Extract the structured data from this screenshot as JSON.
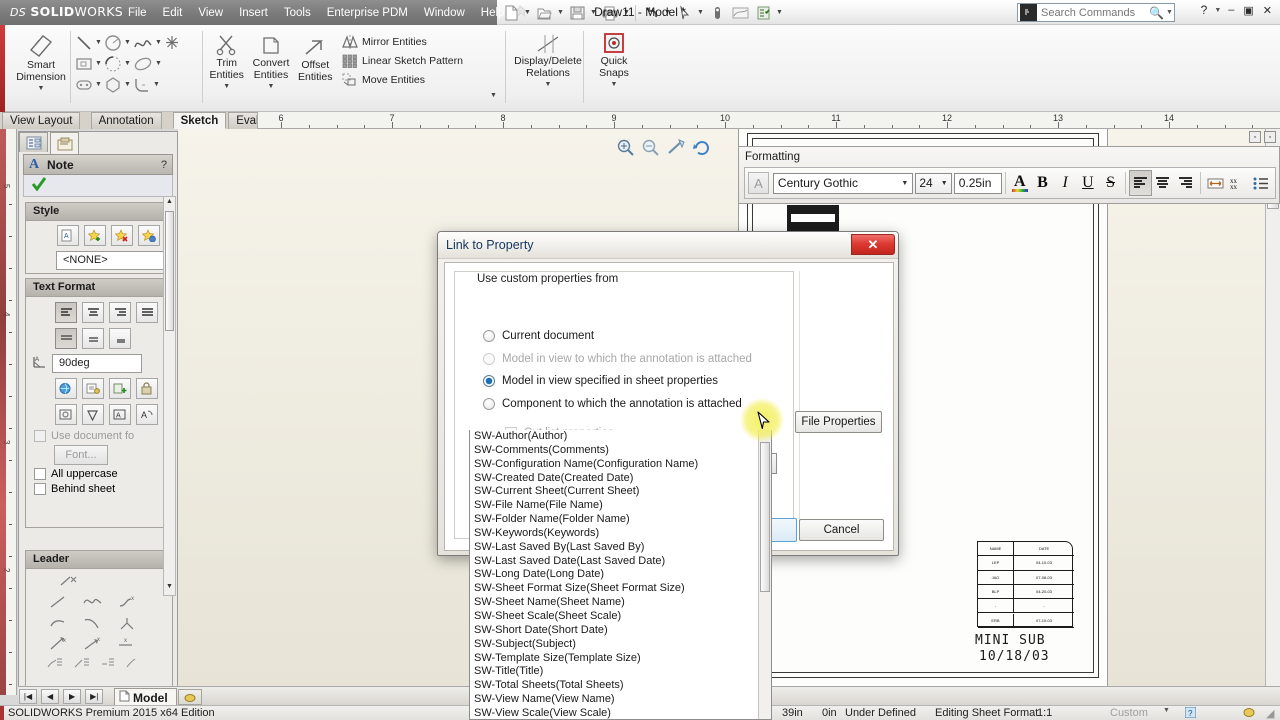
{
  "app": {
    "brand_ds": "DS",
    "brand_name_bold": "SOLID",
    "brand_name_light": "WORKS",
    "document_title": "Draw11 - Model *",
    "status_edition": "SOLIDWORKS Premium 2015 x64 Edition"
  },
  "menu": {
    "items": [
      "File",
      "Edit",
      "View",
      "Insert",
      "Tools",
      "Enterprise PDM",
      "Window",
      "Help"
    ],
    "pin_icon": "pushpin-icon"
  },
  "quickaccess": {
    "items": [
      {
        "name": "new-document-icon",
        "has_caret": true
      },
      {
        "name": "open-document-icon",
        "has_caret": true
      },
      {
        "name": "save-icon",
        "has_caret": true
      },
      {
        "name": "print-icon",
        "has_caret": true
      },
      {
        "name": "undo-icon",
        "has_caret": true
      },
      {
        "name": "select-arrow-icon",
        "has_caret": true
      },
      {
        "name": "measure-icon",
        "has_caret": false
      },
      {
        "name": "section-view-icon",
        "has_caret": false
      },
      {
        "name": "options-icon",
        "has_caret": true
      }
    ]
  },
  "search": {
    "placeholder": "Search Commands",
    "icon": "search-commands-icon",
    "magnifier": "magnifier-icon"
  },
  "window_controls": {
    "help": "?",
    "minimize": "–",
    "restore": "▣",
    "close": "✕"
  },
  "ribbon": {
    "groups": [
      {
        "name": "dimension",
        "buttons": [
          {
            "label_line1": "Smart",
            "label_line2": "Dimension",
            "icon": "smart-dimension-icon",
            "caret": true
          }
        ]
      },
      {
        "name": "sketch-entities",
        "icons": [
          {
            "name": "line-icon",
            "caret": true
          },
          {
            "name": "circle-icon",
            "caret": true
          },
          {
            "name": "spline-icon",
            "caret": true
          },
          {
            "name": "point-icon",
            "caret": false
          },
          {
            "name": "rectangle-icon",
            "caret": true
          },
          {
            "name": "arc-icon",
            "caret": true
          },
          {
            "name": "ellipse-icon",
            "caret": true
          },
          {
            "name": "slot-icon",
            "caret": true
          },
          {
            "name": "polygon-icon",
            "caret": false
          },
          {
            "name": "fillet-icon",
            "caret": true
          }
        ]
      },
      {
        "name": "modify",
        "buttons": [
          {
            "label_line1": "Trim",
            "label_line2": "Entities",
            "icon": "trim-entities-icon",
            "caret": true
          },
          {
            "label_line1": "Convert",
            "label_line2": "Entities",
            "icon": "convert-entities-icon",
            "caret": true
          },
          {
            "label_line1": "Offset",
            "label_line2": "Entities",
            "icon": "offset-entities-icon",
            "caret": false
          }
        ]
      },
      {
        "name": "pattern",
        "small_buttons": [
          {
            "label": "Mirror Entities",
            "icon": "mirror-entities-icon",
            "caret": false
          },
          {
            "label": "Linear Sketch Pattern",
            "icon": "linear-sketch-pattern-icon",
            "caret": true
          },
          {
            "label": "Move Entities",
            "icon": "move-entities-icon",
            "caret": true
          }
        ]
      },
      {
        "name": "relations",
        "buttons": [
          {
            "label_line1": "Display/Delete",
            "label_line2": "Relations",
            "icon": "display-delete-relations-icon",
            "caret": true
          }
        ]
      },
      {
        "name": "snaps",
        "buttons": [
          {
            "label_line1": "Quick",
            "label_line2": "Snaps",
            "icon": "quick-snaps-icon",
            "caret": true
          }
        ]
      }
    ]
  },
  "command_tabs": [
    {
      "label": "View Layout",
      "active": false
    },
    {
      "label": "Annotation",
      "active": false
    },
    {
      "label": "Sketch",
      "active": true
    },
    {
      "label": "Evaluate",
      "active": false
    }
  ],
  "ruler": {
    "top_numbers": [
      "6",
      "7",
      "8",
      "9",
      "10",
      "11",
      "12",
      "13",
      "14"
    ],
    "left_numbers": [
      "5",
      "4",
      "3",
      "2"
    ]
  },
  "property_manager": {
    "tabs": [
      {
        "name": "feature-manager-tab",
        "icon": "feature-tree-icon",
        "active": false
      },
      {
        "name": "property-manager-tab",
        "icon": "property-manager-icon",
        "active": true
      }
    ],
    "header": {
      "icon": "note-A-icon",
      "title": "Note",
      "help": "?"
    },
    "confirm": {
      "icon": "ok-checkmark-icon"
    },
    "sections": [
      {
        "title": "Style",
        "buttons": [
          "apply-style-icon",
          "add-style-icon",
          "delete-style-icon",
          "save-style-icon",
          "load-style-icon"
        ],
        "value": "<NONE>"
      },
      {
        "title": "Text Format",
        "align_buttons": [
          "align-left-icon",
          "align-center-icon",
          "align-right-icon",
          "align-justify-icon"
        ],
        "vertical_buttons": [
          "valign-top-icon",
          "valign-middle-icon",
          "valign-bottom-icon"
        ],
        "angle_icon": "text-angle-icon",
        "angle_value": "90deg",
        "tool_buttons_row1": [
          "insert-hyperlink-icon",
          "link-to-property-icon",
          "add-symbol-icon",
          "lock-note-icon"
        ],
        "tool_buttons_row2": [
          "insert-shape-icon",
          "checkmark-symbol-icon",
          "box-text-icon",
          "rotate-text-icon"
        ],
        "use_doc_font": {
          "label": "Use document fo",
          "checked": false,
          "disabled": true
        },
        "font_button": "Font...",
        "all_uppercase": {
          "label": "All uppercase",
          "checked": false
        },
        "behind_sheet": {
          "label": "Behind sheet",
          "checked": false
        }
      },
      {
        "title": "Leader",
        "rows": [
          [
            "no-leader-icon"
          ],
          [
            "straight-leader-icon",
            "bent-leader-icon",
            "underline-leader-icon"
          ],
          [
            "curve-leader-left-icon",
            "curve-leader-right-icon",
            "multi-leader-icon"
          ],
          [
            "arrow-up-right-icon",
            "arrow-up-left-icon",
            "arrow-flat-icon"
          ],
          [
            "leader-style-1-icon",
            "leader-style-2-icon",
            "leader-style-3-icon",
            "leader-style-4-icon"
          ]
        ]
      }
    ]
  },
  "sheet_bar": {
    "nav_buttons": [
      "first-sheet-icon",
      "previous-sheet-icon",
      "next-sheet-icon",
      "last-sheet-icon"
    ],
    "tab": {
      "icon": "model-sheet-icon",
      "label": "Model"
    },
    "add_tab_icon": "add-sheet-icon"
  },
  "formatting_toolbar": {
    "title": "Formatting",
    "font_style_icon": "font-style-icon",
    "font_name": "Century Gothic",
    "font_size": "24",
    "text_height": "0.25in",
    "buttons": [
      {
        "name": "font-color-button",
        "glyph": "A"
      },
      {
        "name": "bold-button",
        "glyph": "B"
      },
      {
        "name": "italic-button",
        "glyph": "I"
      },
      {
        "name": "underline-button",
        "glyph": "U"
      },
      {
        "name": "strikethrough-button",
        "glyph": "S"
      },
      {
        "name": "align-left-button",
        "glyph": "≡",
        "selected": true
      },
      {
        "name": "align-center-button",
        "glyph": "≡"
      },
      {
        "name": "align-right-button",
        "glyph": "≡"
      },
      {
        "name": "stretch-text-button",
        "glyph": "↔"
      },
      {
        "name": "superscript-subscript-button",
        "glyph": "xx"
      },
      {
        "name": "bullet-list-button",
        "glyph": "☰"
      }
    ]
  },
  "view_toolbar": {
    "icons": [
      "zoom-to-fit-icon",
      "zoom-to-area-icon",
      "zoom-previous-icon",
      "rotate-view-icon"
    ]
  },
  "drawing": {
    "title_block": {
      "header": [
        "NAME",
        "DATE"
      ],
      "rows": [
        [
          "LEP",
          "04-10-03"
        ],
        [
          "JAG",
          "07-08-03"
        ],
        [
          "BLP",
          "04-20-03"
        ],
        [
          "-",
          "-"
        ],
        [
          "ERB",
          "07-10-03"
        ]
      ],
      "part_name": "MINI SUB",
      "part_date": "10/18/03"
    }
  },
  "dialog": {
    "title": "Link to Property",
    "close_glyph": "✕",
    "group_label": "Use custom properties from",
    "options": [
      {
        "label": "Current document",
        "selected": false,
        "disabled": false
      },
      {
        "label": "Model in view to which the annotation is attached",
        "selected": false,
        "disabled": true
      },
      {
        "label": "Model in view specified in sheet properties",
        "selected": true,
        "disabled": false
      },
      {
        "label": "Component to which the annotation is attached",
        "selected": false,
        "disabled": false
      }
    ],
    "cut_list": {
      "label": "Cut list properties",
      "checked": false,
      "disabled": true
    },
    "property_input": {
      "value": "",
      "dropdown_icon": "dropdown-arrow-icon"
    },
    "file_properties_button": "File Properties",
    "cancel_button": "Cancel",
    "ok_button": "",
    "dropdown_items": [
      "SW-Author(Author)",
      "SW-Comments(Comments)",
      "SW-Configuration Name(Configuration Name)",
      "SW-Created Date(Created Date)",
      "SW-Current Sheet(Current Sheet)",
      "SW-File Name(File Name)",
      "SW-Folder Name(Folder Name)",
      "SW-Keywords(Keywords)",
      "SW-Last Saved By(Last Saved By)",
      "SW-Last Saved Date(Last Saved Date)",
      "SW-Long Date(Long Date)",
      "SW-Sheet Format Size(Sheet Format Size)",
      "SW-Sheet Name(Sheet Name)",
      "SW-Sheet Scale(Sheet Scale)",
      "SW-Short Date(Short Date)",
      "SW-Subject(Subject)",
      "SW-Template Size(Template Size)",
      "SW-Title(Title)",
      "SW-Total Sheets(Total Sheets)",
      "SW-View Name(View Name)",
      "SW-View Scale(View Scale)"
    ]
  },
  "status_bar": {
    "edition": "SOLIDWORKS Premium 2015 x64 Edition",
    "coord_x": "39in",
    "coord_y": "0in",
    "state": "Under Defined",
    "mode": "Editing Sheet Format",
    "scale": "1:1",
    "custom": "Custom",
    "help_icon": "help-badge-icon",
    "tag_icon": "tag-icon"
  },
  "colors": {
    "accent_blue": "#1e6fb5",
    "close_red": "#c2241c",
    "canvas": "#f2efe6",
    "ribbon_red": "#a33",
    "highlight_yellow": "#f3f05a"
  }
}
